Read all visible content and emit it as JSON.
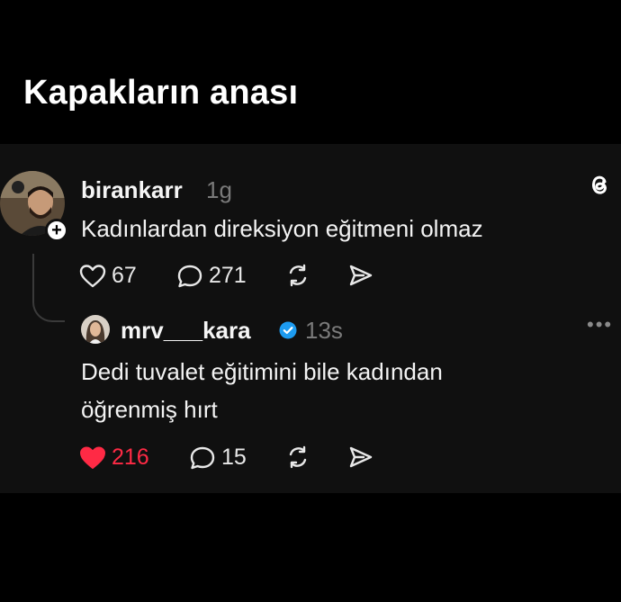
{
  "caption": "Kapakların anası",
  "post": {
    "username": "birankarr",
    "time": "1g",
    "text": "Kadınlardan direksiyon eğitmeni olmaz",
    "likes": "67",
    "comments": "271",
    "follow_symbol": "+"
  },
  "reply": {
    "username": "mrv___kara",
    "time": "13s",
    "text_line1": "Dedi tuvalet eğitimini bile kadından",
    "text_line2": "öğrenmiş hırt",
    "likes": "216",
    "comments": "15",
    "liked": true
  },
  "icons": {
    "logo": "threads-logo-icon",
    "like": "heart-icon",
    "comment": "comment-bubble-icon",
    "repost": "repost-icon",
    "share": "send-icon",
    "verified": "verified-badge-icon",
    "more": "more-dots-icon"
  },
  "colors": {
    "background": "#000000",
    "card": "#101010",
    "like_active": "#ff2a45",
    "verified": "#1d9bf0",
    "muted": "#7a7a7a"
  }
}
